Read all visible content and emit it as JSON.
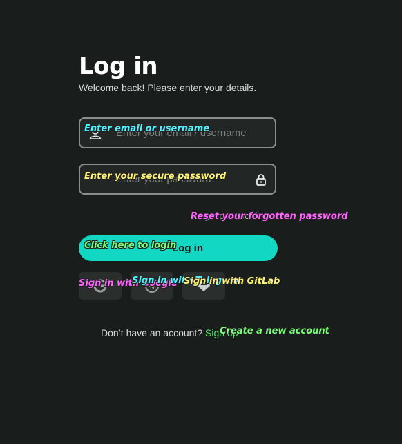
{
  "header": {
    "title": "Log in",
    "subtitle": "Welcome back! Please enter your details."
  },
  "form": {
    "username": {
      "placeholder": "Enter your email / username",
      "icon": "user-icon",
      "annotation": "Enter email or username"
    },
    "password": {
      "placeholder": "Enter your password",
      "icon": "lock-icon",
      "annotation": "Enter your secure password"
    },
    "forgot": {
      "label": "Forgot password?",
      "annotation": "Reset your forgotten password"
    },
    "login": {
      "label": "Log in",
      "annotation": "Click here to login"
    }
  },
  "social": [
    {
      "name": "Google",
      "icon": "google-icon",
      "annotation": "Sign in with Google"
    },
    {
      "name": "Telegram",
      "icon": "telegram-icon",
      "annotation": "Sign in with Telegram"
    },
    {
      "name": "GitLab",
      "icon": "gitlab-icon",
      "annotation": "Sign in with GitLab"
    }
  ],
  "footer": {
    "prompt": "Don’t have an account?",
    "link": "Sign up",
    "annotation": "Create a new account"
  },
  "colors": {
    "background": "#191d1c",
    "accent": "#12d8c3",
    "link": "#55e86d"
  }
}
